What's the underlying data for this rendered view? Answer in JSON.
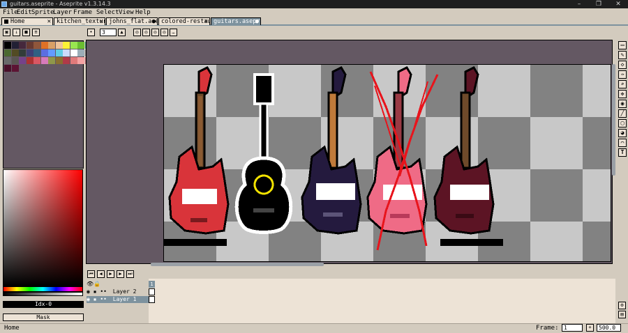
{
  "window": {
    "title": "guitars.aseprite - Aseprite v1.3.14.3",
    "minimize": "–",
    "maximize": "❐",
    "close": "✕"
  },
  "menu": [
    "File",
    "Edit",
    "Sprite",
    "Layer",
    "Frame",
    "Select",
    "View",
    "Help"
  ],
  "tabs": [
    {
      "label": "Home",
      "close": "✕"
    },
    {
      "label": "kitchen_textur",
      "close": "✕"
    },
    {
      "label": "johns_flat.asepr",
      "close": "●"
    },
    {
      "label": "colored-restaur",
      "close": "✕"
    },
    {
      "label": "guitars.aseprite",
      "close": "●"
    }
  ],
  "toolbar": {
    "brush_size": "3"
  },
  "colorbar": {
    "index_label": "Idx-0",
    "mask_label": "Mask"
  },
  "palette_colors": [
    "#000000",
    "#222034",
    "#45283c",
    "#663931",
    "#8f563b",
    "#df7126",
    "#d9a066",
    "#eec39a",
    "#fbf236",
    "#99e550",
    "#6abe30",
    "#37946e",
    "#4b692f",
    "#524b24",
    "#323c39",
    "#3f3f74",
    "#306082",
    "#5b6ee1",
    "#639bff",
    "#5fcde4",
    "#cbdbfc",
    "#ffffff",
    "#9badb7",
    "#847e87",
    "#696a6a",
    "#595652",
    "#76428a",
    "#ac3232",
    "#d95763",
    "#d77bba",
    "#8f974a",
    "#8a6f30",
    "#b03a48",
    "#e07a7a",
    "#f4a3a3",
    "#c06070",
    "#4b0f2a",
    "#5c1434"
  ],
  "tools": [
    "▭",
    "✎",
    "◇",
    "✑",
    "⌕",
    "✥",
    "◉",
    "╱",
    "▢",
    "◕",
    "⌒",
    "T"
  ],
  "timeline": {
    "layers": [
      {
        "name": "",
        "selected": false
      },
      {
        "name": "Layer 2",
        "selected": false
      },
      {
        "name": "Layer 1",
        "selected": true
      }
    ],
    "frame_number": "1"
  },
  "status": {
    "left": "Home",
    "frame_label": "Frame:",
    "frame_value": "1",
    "zoom_value": "500.0"
  }
}
